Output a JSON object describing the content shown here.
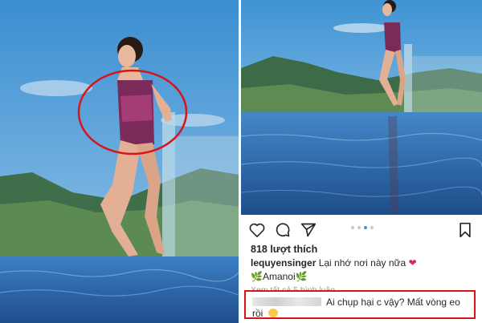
{
  "post": {
    "likes": "818 lượt thích",
    "username": "lequyensinger",
    "caption": "Lại nhớ nơi này nữa",
    "location": "🌿Amanoi🌿",
    "view_comments": "Xem tất cả 5 bình luận",
    "comment_text": "Ai chụp hại c vậy? Mất vòng eo",
    "comment_text_2": "rồi"
  },
  "icons": [
    "heart-icon",
    "comment-icon",
    "share-icon",
    "bookmark-icon"
  ],
  "colors": {
    "highlight": "#d7141b",
    "active_dot": "#3897f0",
    "sky": "#4f9fd6",
    "water": "#2f6fb3"
  },
  "carousel": {
    "dots": 4,
    "active_index": 2
  }
}
